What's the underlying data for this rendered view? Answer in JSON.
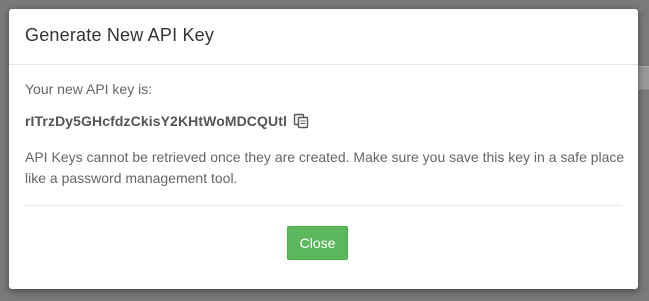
{
  "modal": {
    "title": "Generate New API Key",
    "intro": "Your new API key is:",
    "api_key": "rITrzDy5GHcfdzCkisY2KHtWoMDCQUtl",
    "copy_icon": "copy-icon",
    "warning": "API Keys cannot be retrieved once they are created. Make sure you save this key in a safe place like a password management tool.",
    "close_label": "Close"
  },
  "colors": {
    "accent": "#5cb85c",
    "backdrop": "#7a7a7a",
    "text": "#666666"
  }
}
